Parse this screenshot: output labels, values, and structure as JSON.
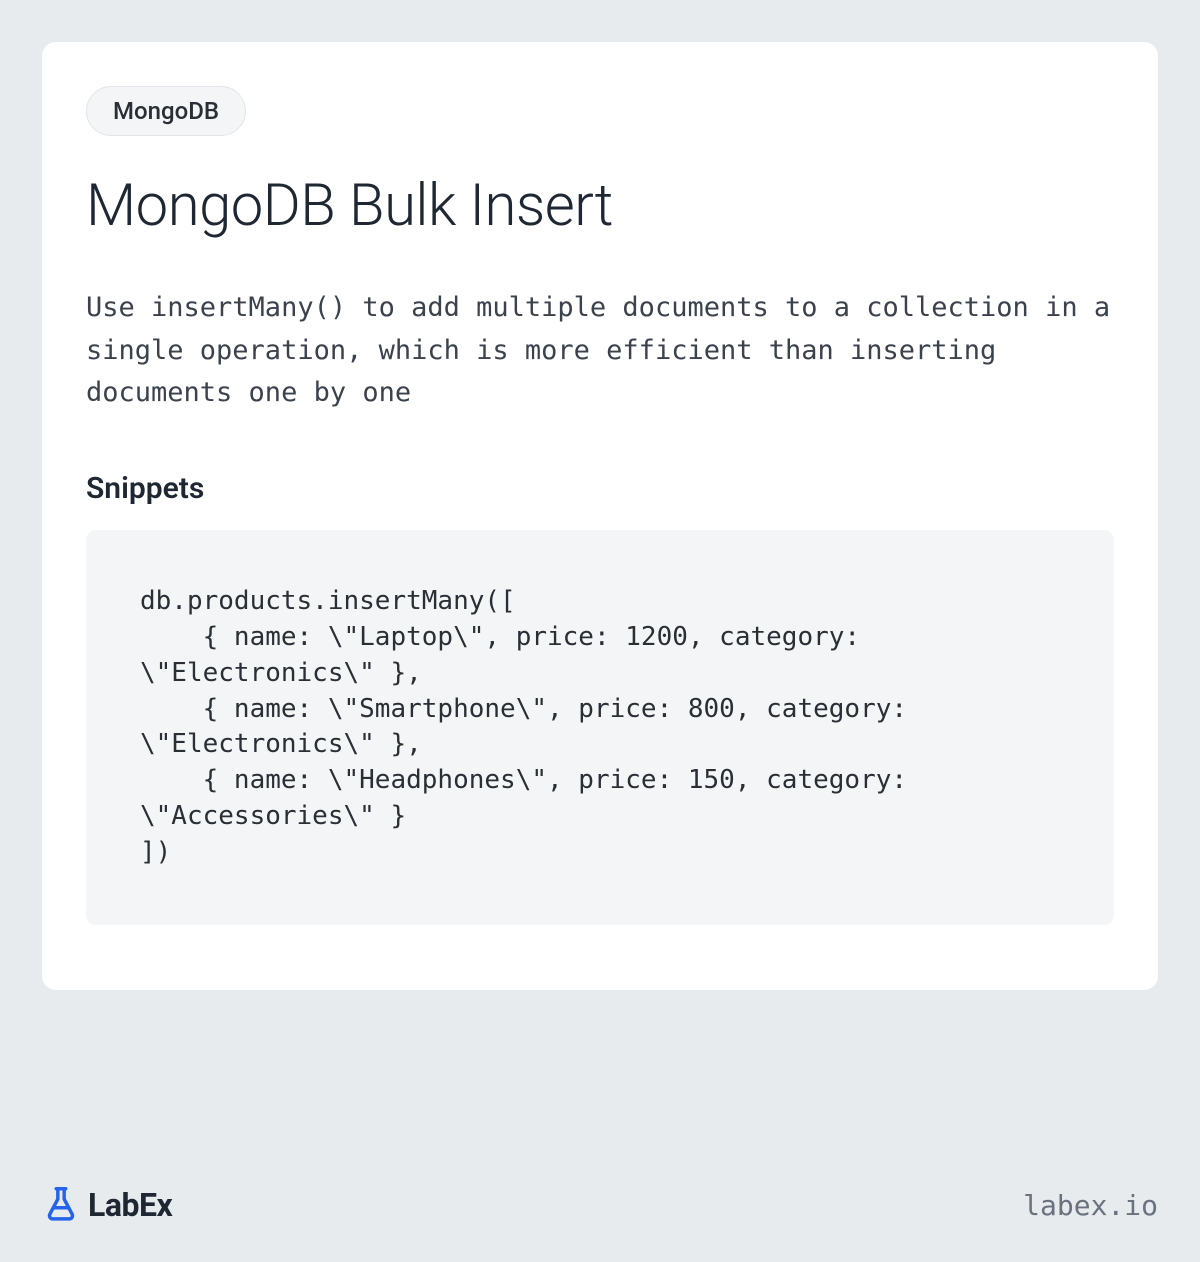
{
  "tag": "MongoDB",
  "title": "MongoDB Bulk Insert",
  "description": "Use insertMany() to add multiple documents to a collection in a single operation, which is more efficient than inserting documents one by one",
  "snippets_heading": "Snippets",
  "code": "db.products.insertMany([\n    { name: \\\"Laptop\\\", price: 1200, category: \\\"Electronics\\\" },\n    { name: \\\"Smartphone\\\", price: 800, category: \\\"Electronics\\\" },\n    { name: \\\"Headphones\\\", price: 150, category: \\\"Accessories\\\" }\n])",
  "logo_text": "LabEx",
  "url": "labex.io"
}
